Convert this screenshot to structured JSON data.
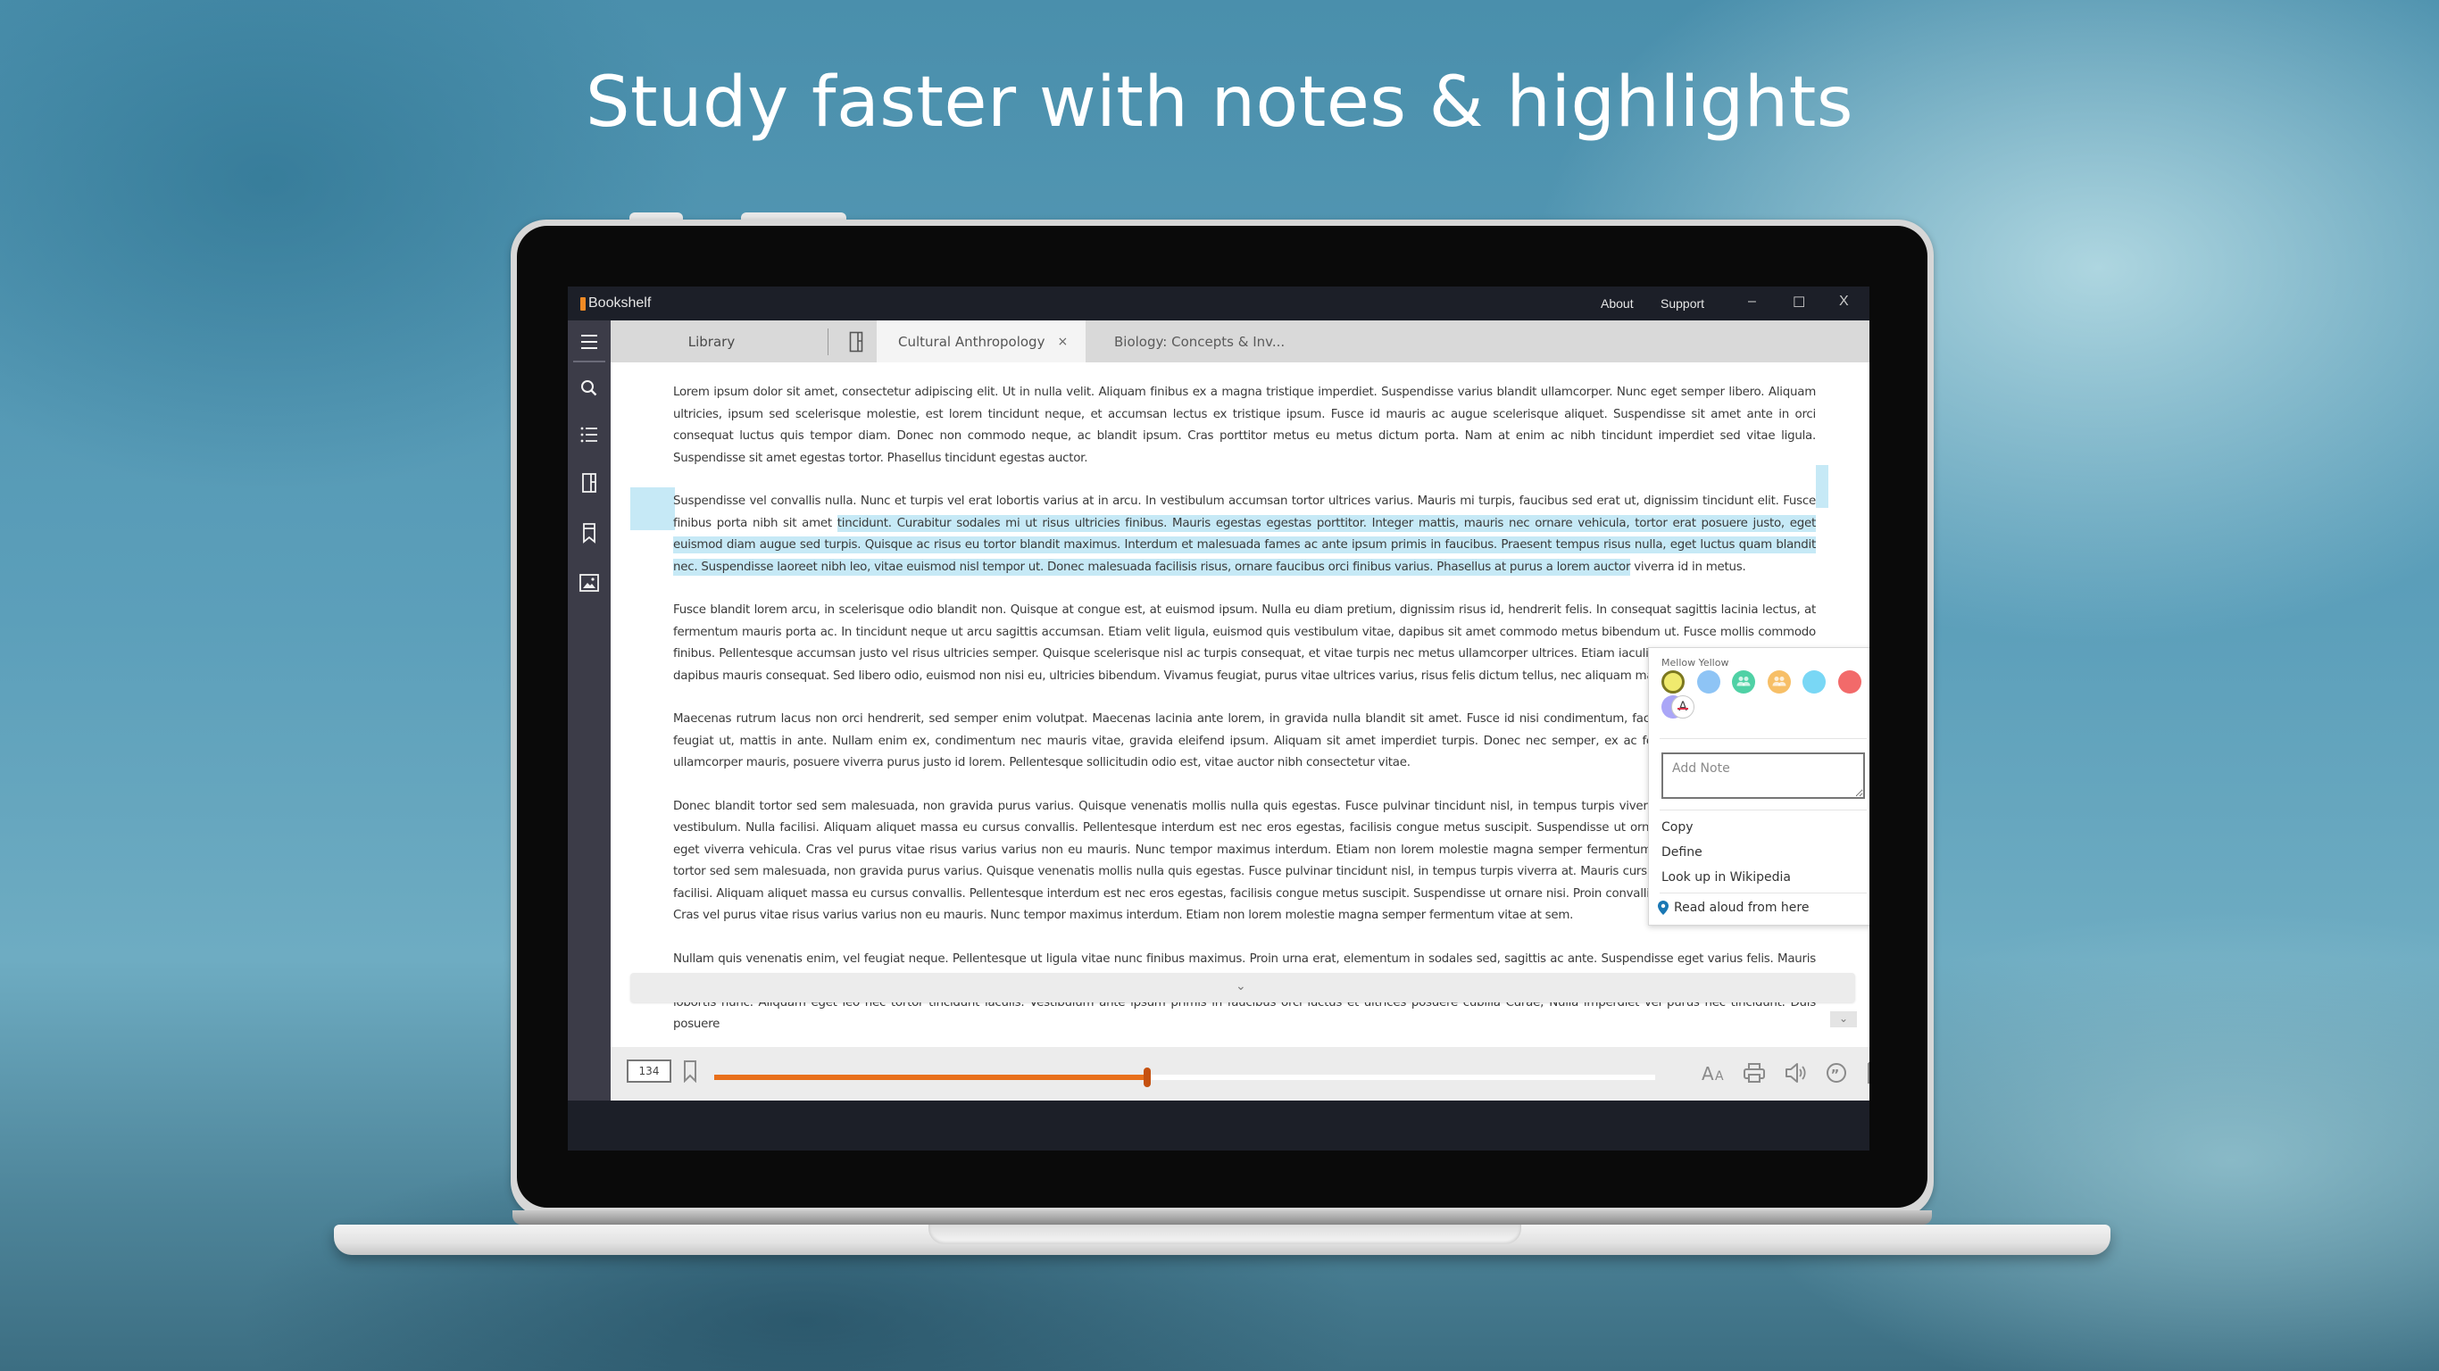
{
  "headline": "Study faster with notes & highlights",
  "app": {
    "title": "Bookshelf",
    "links": {
      "about": "About",
      "support": "Support"
    },
    "window_controls": {
      "minimize": "–",
      "maximize": "☐",
      "close": "X"
    }
  },
  "sidebar": {
    "items": [
      {
        "icon": "menu-icon"
      },
      {
        "icon": "search-icon"
      },
      {
        "icon": "table-of-contents-icon"
      },
      {
        "icon": "book-icon"
      },
      {
        "icon": "bookmark-icon"
      },
      {
        "icon": "image-icon"
      }
    ]
  },
  "tabs": {
    "library": "Library",
    "active": "Cultural Anthropology",
    "active_close": "×",
    "other": "Biology: Concepts & Inv..."
  },
  "reader": {
    "paragraphs": [
      {
        "text": "Lorem ipsum dolor sit amet, consectetur adipiscing elit. Ut in nulla velit. Aliquam finibus ex a magna tristique imperdiet. Suspendisse varius blandit ullamcorper. Nunc eget semper libero. Aliquam ultricies, ipsum sed scelerisque molestie, est lorem tincidunt neque, et accumsan lectus ex tristique ipsum. Fusce id mauris ac augue scelerisque aliquet. Suspendisse sit amet ante in orci consequat luctus quis tempor diam. Donec non commodo neque, ac blandit ipsum. Cras porttitor metus eu metus dictum porta. Nam at enim ac nibh tincidunt imperdiet sed vitae ligula. Suspendisse sit amet egestas tortor. Phasellus tincidunt egestas auctor."
      },
      {
        "before": "Suspendisse vel convallis nulla. Nunc et turpis vel erat lobortis varius at in arcu. In vestibulum accumsan tortor ultrices varius. Mauris mi turpis, faucibus sed erat ut, dignissim tincidunt elit. Fusce finibus porta nibh sit amet ",
        "highlighted": "tincidunt. Curabitur sodales mi ut risus ultricies finibus. Mauris egestas egestas porttitor. Integer mattis, mauris nec ornare vehicula, tortor erat posuere justo, eget euismod diam augue sed turpis. Quisque ac risus eu tortor blandit maximus. Interdum et malesuada fames ac ante ipsum primis in faucibus. Praesent tempus risus nulla, eget luctus quam blandit nec. Suspendisse laoreet nibh leo, vitae euismod nisl tempor ut. Donec malesuada facilisis risus, ornare faucibus orci finibus varius. Phasellus at purus a lorem auctor",
        "after": " viverra id in metus."
      },
      {
        "text": "Fusce blandit lorem arcu, in scelerisque odio blandit non. Quisque at congue est, at euismod ipsum. Nulla eu diam pretium, dignissim risus id, hendrerit felis. In consequat sagittis lacinia lectus, at fermentum mauris porta ac. In tincidunt neque ut arcu sagittis accumsan. Etiam velit ligula, euismod quis vestibulum vitae, dapibus sit amet commodo metus bibendum ut. Fusce mollis commodo finibus. Pellentesque accumsan justo vel risus ultricies semper. Quisque scelerisque nisl ac turpis consequat, et vitae turpis nec metus ullamcorper ultrices. Etiam iaculis odio sed nisl consequat, ac dapibus mauris consequat. Sed libero odio, euismod non nisi eu, ultricies bibendum. Vivamus feugiat, purus vitae ultrices varius, risus felis dictum tellus, nec aliquam magna diam quis nibh."
      },
      {
        "text": "Maecenas rutrum lacus non orci hendrerit, sed semper enim volutpat. Maecenas lacinia ante lorem, in gravida nulla blandit sit amet. Fusce id nisi condimentum, facilisis ante, euismod faucibus feugiat ut, mattis in ante. Nullam enim ex, condimentum nec mauris vitae, gravida eleifend ipsum. Aliquam sit amet imperdiet turpis. Donec nec semper, ex ac fermentum cursus, libero nisi ullamcorper mauris, posuere viverra purus justo id lorem. Pellentesque sollicitudin odio est, vitae auctor nibh consectetur vitae."
      },
      {
        "text": "Donec blandit tortor sed sem malesuada, non gravida purus varius. Quisque venenatis mollis nulla quis egestas. Fusce pulvinar tincidunt nisl, in tempus turpis viverra at. Mauris cursus posuere vestibulum. Nulla facilisi. Aliquam aliquet massa eu cursus convallis. Pellentesque interdum est nec eros egestas, facilisis congue metus suscipit. Suspendisse ut ornare nisi. Proin convallis risus eget viverra vehicula. Cras vel purus vitae risus varius varius non eu mauris. Nunc tempor maximus interdum. Etiam non lorem molestie magna semper fermentum vitae at sem.Donec blandit tortor sed sem malesuada, non gravida purus varius. Quisque venenatis mollis nulla quis egestas. Fusce pulvinar tincidunt nisl, in tempus turpis viverra at. Mauris cursus posuere vestibulum. Nulla facilisi. Aliquam aliquet massa eu cursus convallis. Pellentesque interdum est nec eros egestas, facilisis congue metus suscipit. Suspendisse ut ornare nisi. Proin convallis risus eget viverra vehicula. Cras vel purus vitae risus varius varius non eu mauris. Nunc tempor maximus interdum. Etiam non lorem molestie magna semper fermentum vitae at sem."
      },
      {
        "text": "Nullam quis venenatis enim, vel feugiat neque. Pellentesque ut ligula vitae nunc finibus maximus. Proin urna erat, elementum in sodales sed, sagittis ac ante. Suspendisse eget varius felis. Mauris varius sapien ut commodo egestas. Fusce justo magna, malesuada sit amet urna nec, posuere imperdiet metus. Cras suscipit viverra pellentesque. In eu ultrices ligula, vitae pellentesque felis. Ut in lobortis nunc. Aliquam eget leo nec tortor tincidunt iaculis. Vestibulum ante ipsum primis in faucibus orci luctus et ultrices posuere cubilia Curae; Nulla imperdiet vel purus nec tincidunt. Duis posuere"
      }
    ],
    "scroll_chevron": "⌄",
    "highlight_color": "#c6e9f6"
  },
  "popup": {
    "selected_color_name": "Mellow Yellow",
    "colors": [
      {
        "name": "Mellow Yellow",
        "hex": "#f0ea6e",
        "selected": true,
        "shared": false
      },
      {
        "name": "Blue",
        "hex": "#8ec4f5",
        "selected": false,
        "shared": false
      },
      {
        "name": "Green",
        "hex": "#4fd1a5",
        "selected": false,
        "shared": true
      },
      {
        "name": "Orange",
        "hex": "#f7bf67",
        "selected": false,
        "shared": true
      },
      {
        "name": "Cyan",
        "hex": "#79d7f5",
        "selected": false,
        "shared": false
      },
      {
        "name": "Red",
        "hex": "#f26a6a",
        "selected": false,
        "shared": false
      },
      {
        "name": "Purple",
        "hex": "#aaa6f7",
        "selected": false,
        "shared": false
      }
    ],
    "remove_highlight_glyph": "A",
    "note_placeholder": "Add Note",
    "note_value": "",
    "menu": {
      "copy": "Copy",
      "define": "Define",
      "wikipedia": "Look up in Wikipedia",
      "read_aloud": "Read aloud from here"
    }
  },
  "bottombar": {
    "page_number": "134",
    "progress_fraction": 0.46,
    "accent": "#e8701b",
    "tools": [
      "text-size-icon",
      "print-icon",
      "speaker-icon",
      "quote-icon",
      "notes-share-icon"
    ],
    "text_size_label": "AA"
  }
}
